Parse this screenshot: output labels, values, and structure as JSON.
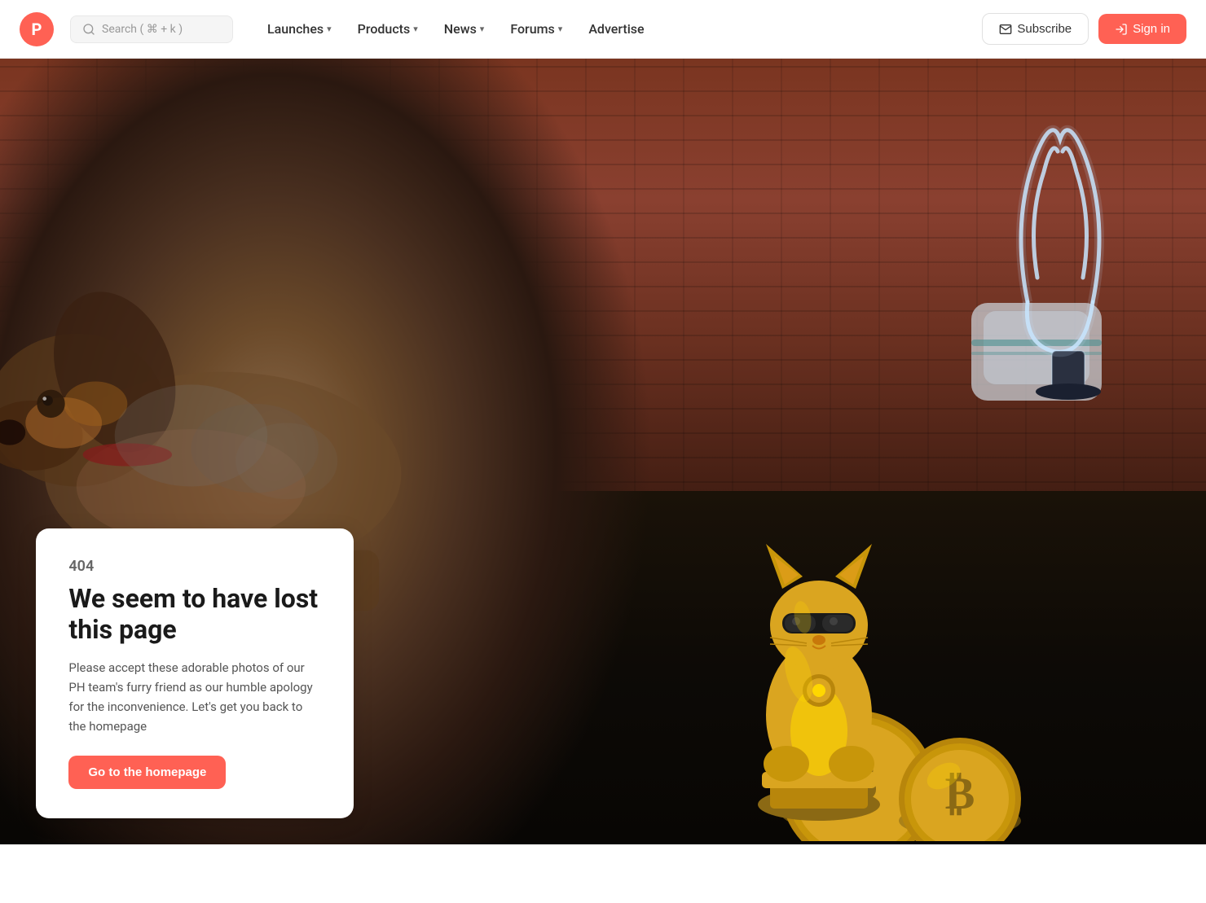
{
  "navbar": {
    "logo_letter": "P",
    "logo_color": "#ff6154",
    "search_placeholder": "Search ( ⌘ + k )",
    "nav_items": [
      {
        "label": "Launches",
        "has_chevron": true
      },
      {
        "label": "Products",
        "has_chevron": true
      },
      {
        "label": "News",
        "has_chevron": true
      },
      {
        "label": "Forums",
        "has_chevron": true
      },
      {
        "label": "Advertise",
        "has_chevron": false
      }
    ],
    "subscribe_label": "Subscribe",
    "signin_label": "Sign in"
  },
  "error_page": {
    "code": "404",
    "title": "We seem to have lost this page",
    "description": "Please accept these adorable photos of our PH team's furry friend as our humble apology for the inconvenience. Let's get you back to the homepage",
    "homepage_button": "Go to the homepage"
  }
}
